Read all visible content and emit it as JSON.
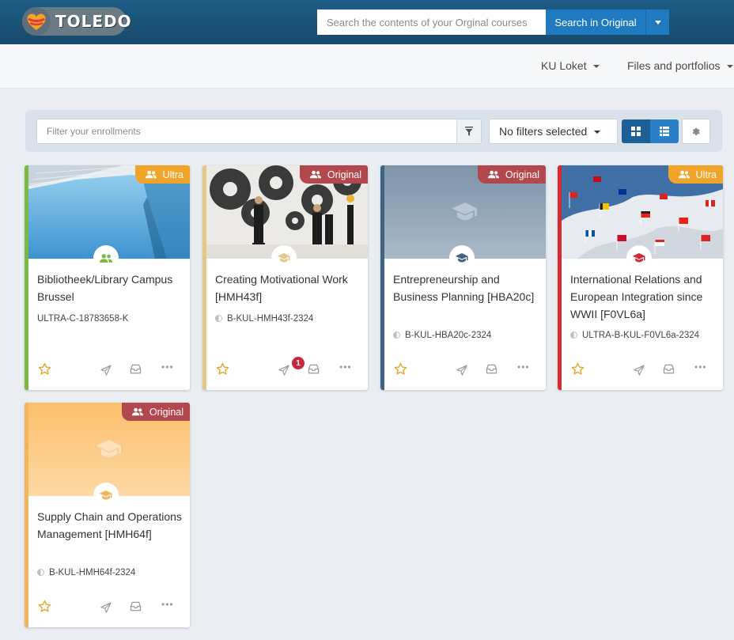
{
  "header": {
    "logo_text": "TOLEDO",
    "search_placeholder": "Search the contents of your Orginal courses",
    "search_button": "Search in Original"
  },
  "nav": {
    "items": [
      {
        "label": "KU Loket"
      },
      {
        "label": "Files and portfolios"
      }
    ]
  },
  "filter": {
    "placeholder": "Filter your enrollments",
    "select_label": "No filters selected"
  },
  "colors": {
    "ultra_badge": "#f0a52a",
    "original_badge": "#b2474e",
    "star": "#e0a52a",
    "header": "#1e5c86",
    "accent": "#1f7ac0"
  },
  "courses": [
    {
      "title": "Bibliotheek/Library Campus Brussel",
      "code": "ULTRA-C-18783658-K",
      "badge": "Ultra",
      "stripe": "#7ab944",
      "icon": "people-icon",
      "notifications": ""
    },
    {
      "title": "Creating Motivational Work [HMH43f]",
      "code": "B-KUL-HMH43f-2324",
      "badge": "Original",
      "stripe": "#e4c88a",
      "icon": "graduation-cap-icon",
      "notifications": "1"
    },
    {
      "title": "Entrepreneurship and Business Planning [HBA20c]",
      "code": "B-KUL-HBA20c-2324",
      "badge": "Original",
      "stripe": "#3f6483",
      "icon": "graduation-cap-icon",
      "notifications": ""
    },
    {
      "title": "International Relations and European Integration since WWII [F0VL6a]",
      "code": "ULTRA-B-KUL-F0VL6a-2324",
      "badge": "Ultra",
      "stripe": "#d32a35",
      "icon": "graduation-cap-icon",
      "notifications": ""
    },
    {
      "title": "Supply Chain and Operations Management [HMH64f]",
      "code": "B-KUL-HMH64f-2324",
      "badge": "Original",
      "stripe": "#f5b55a",
      "icon": "graduation-cap-icon",
      "notifications": ""
    }
  ]
}
